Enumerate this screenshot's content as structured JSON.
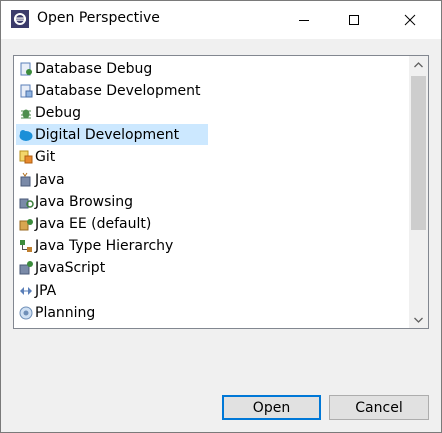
{
  "window": {
    "title": "Open Perspective"
  },
  "list": {
    "items": [
      {
        "label": "Database Debug",
        "icon": "database-debug-icon"
      },
      {
        "label": "Database Development",
        "icon": "database-development-icon"
      },
      {
        "label": "Debug",
        "icon": "debug-bug-icon"
      },
      {
        "label": "Digital Development",
        "icon": "digital-development-icon",
        "selected": true
      },
      {
        "label": "Git",
        "icon": "git-icon"
      },
      {
        "label": "Java",
        "icon": "java-icon"
      },
      {
        "label": "Java Browsing",
        "icon": "java-browsing-icon"
      },
      {
        "label": "Java EE (default)",
        "icon": "java-ee-icon"
      },
      {
        "label": "Java Type Hierarchy",
        "icon": "java-type-hierarchy-icon"
      },
      {
        "label": "JavaScript",
        "icon": "javascript-icon"
      },
      {
        "label": "JPA",
        "icon": "jpa-icon"
      },
      {
        "label": "Planning",
        "icon": "planning-icon"
      }
    ]
  },
  "buttons": {
    "open": "Open",
    "cancel": "Cancel"
  },
  "colors": {
    "selection": "#cce8ff",
    "accent": "#0078d7"
  }
}
